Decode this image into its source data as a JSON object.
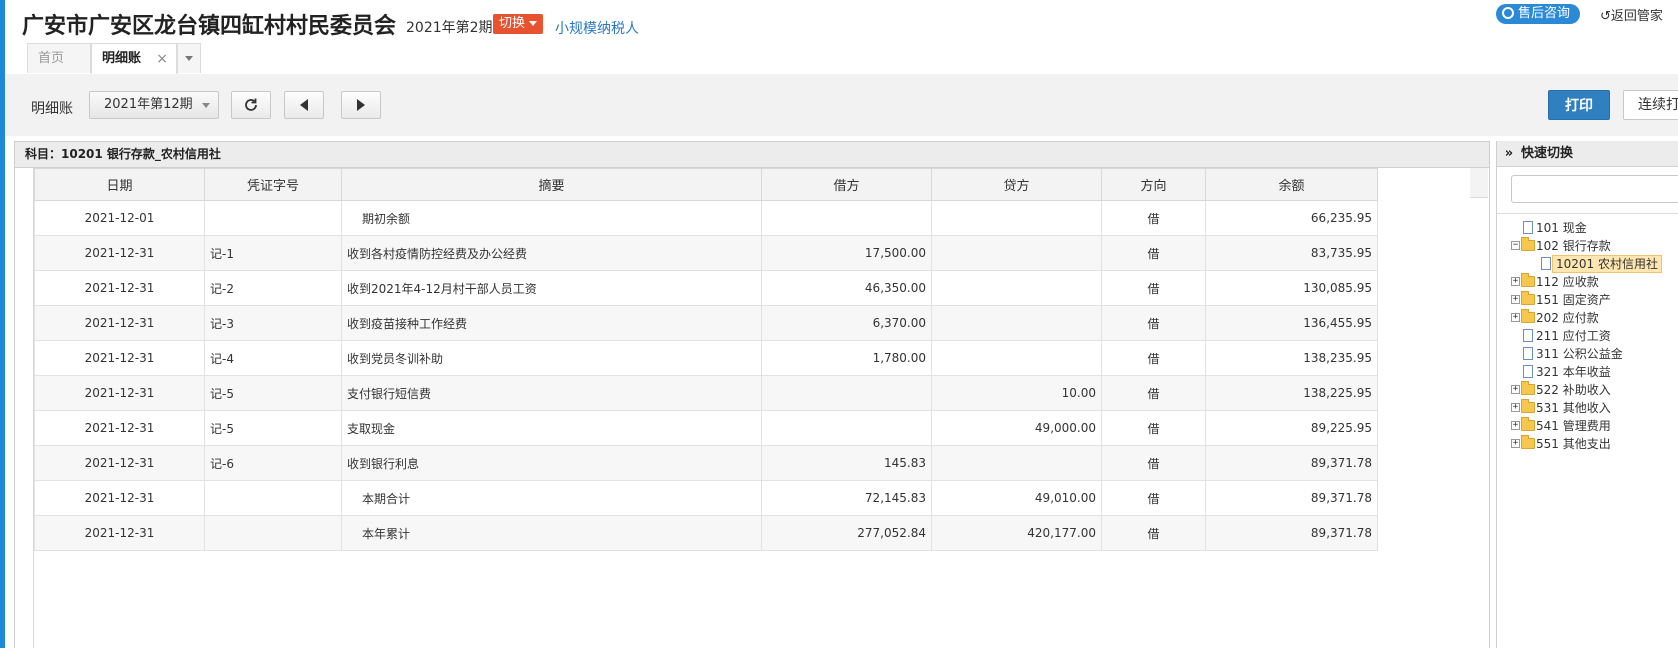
{
  "header": {
    "company_name": "广安市广安区龙台镇四缸村村民委员会",
    "period": "2021年第2期",
    "switch_label": "切换",
    "taxpayer_type": "小规模纳税人",
    "after_sale_label": "售后咨询",
    "back_label": "返回管家"
  },
  "tabs": [
    {
      "label": "首页",
      "active": false
    },
    {
      "label": "明细账",
      "active": true,
      "close": "×"
    }
  ],
  "toolbar": {
    "label": "明细账",
    "period_value": "2021年第12期",
    "print_label": "打印",
    "continuous_print_label": "连续打印"
  },
  "ledger": {
    "subject_title": "科目：10201 银行存款_农村信用社",
    "columns": [
      "日期",
      "凭证字号",
      "摘要",
      "借方",
      "贷方",
      "方向",
      "余额"
    ],
    "rows": [
      {
        "date": "2021-12-01",
        "voucher": "",
        "summary": "期初余额",
        "debit": "",
        "credit": "",
        "direction": "借",
        "balance": "66,235.95"
      },
      {
        "date": "2021-12-31",
        "voucher": "记-1",
        "summary": "收到各村疫情防控经费及办公经费",
        "debit": "17,500.00",
        "credit": "",
        "direction": "借",
        "balance": "83,735.95"
      },
      {
        "date": "2021-12-31",
        "voucher": "记-2",
        "summary": "收到2021年4-12月村干部人员工资",
        "debit": "46,350.00",
        "credit": "",
        "direction": "借",
        "balance": "130,085.95"
      },
      {
        "date": "2021-12-31",
        "voucher": "记-3",
        "summary": "收到疫苗接种工作经费",
        "debit": "6,370.00",
        "credit": "",
        "direction": "借",
        "balance": "136,455.95"
      },
      {
        "date": "2021-12-31",
        "voucher": "记-4",
        "summary": "收到党员冬训补助",
        "debit": "1,780.00",
        "credit": "",
        "direction": "借",
        "balance": "138,235.95"
      },
      {
        "date": "2021-12-31",
        "voucher": "记-5",
        "summary": "支付银行短信费",
        "debit": "",
        "credit": "10.00",
        "direction": "借",
        "balance": "138,225.95"
      },
      {
        "date": "2021-12-31",
        "voucher": "记-5",
        "summary": "支取现金",
        "debit": "",
        "credit": "49,000.00",
        "direction": "借",
        "balance": "89,225.95"
      },
      {
        "date": "2021-12-31",
        "voucher": "记-6",
        "summary": "收到银行利息",
        "debit": "145.83",
        "credit": "",
        "direction": "借",
        "balance": "89,371.78"
      },
      {
        "date": "2021-12-31",
        "voucher": "",
        "summary": "本期合计",
        "debit": "72,145.83",
        "credit": "49,010.00",
        "direction": "借",
        "balance": "89,371.78"
      },
      {
        "date": "2021-12-31",
        "voucher": "",
        "summary": "本年累计",
        "debit": "277,052.84",
        "credit": "420,177.00",
        "direction": "借",
        "balance": "89,371.78"
      }
    ]
  },
  "quick_switch": {
    "collapse_glyph": "»",
    "title": "快速切换",
    "tree": [
      {
        "label": "101 现金",
        "type": "file",
        "expander": ""
      },
      {
        "label": "102 银行存款",
        "type": "folder",
        "expander": "−"
      },
      {
        "label": "10201 农村信用社",
        "type": "file",
        "expander": "",
        "child": true,
        "selected": true
      },
      {
        "label": "112 应收款",
        "type": "folder",
        "expander": "+"
      },
      {
        "label": "151 固定资产",
        "type": "folder",
        "expander": "+"
      },
      {
        "label": "202 应付款",
        "type": "folder",
        "expander": "+"
      },
      {
        "label": "211 应付工资",
        "type": "file",
        "expander": ""
      },
      {
        "label": "311 公积公益金",
        "type": "file",
        "expander": ""
      },
      {
        "label": "321 本年收益",
        "type": "file",
        "expander": ""
      },
      {
        "label": "522 补助收入",
        "type": "folder",
        "expander": "+"
      },
      {
        "label": "531 其他收入",
        "type": "folder",
        "expander": "+"
      },
      {
        "label": "541 管理费用",
        "type": "folder",
        "expander": "+"
      },
      {
        "label": "551 其他支出",
        "type": "folder",
        "expander": "+"
      }
    ]
  }
}
